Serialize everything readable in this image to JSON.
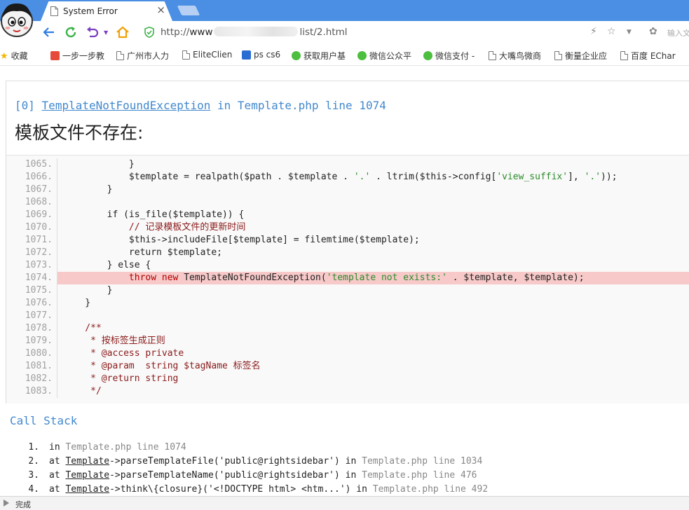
{
  "tab": {
    "title": "System Error",
    "close": "×"
  },
  "address": {
    "scheme": "http://",
    "host": "www",
    "path": "list/2.html",
    "search_placeholder": "输入文"
  },
  "bookmarks": [
    {
      "label": "收藏",
      "icon": "star-icon"
    },
    {
      "label": "一步一步教",
      "icon": "red-app-icon"
    },
    {
      "label": "广州市人力",
      "icon": "page-icon"
    },
    {
      "label": "EliteClien",
      "icon": "page-icon"
    },
    {
      "label": "ps cs6",
      "icon": "ps-icon"
    },
    {
      "label": "获取用户基",
      "icon": "wechat-icon"
    },
    {
      "label": "微信公众平",
      "icon": "wechat-icon"
    },
    {
      "label": "微信支付 -",
      "icon": "wechat-icon"
    },
    {
      "label": "大嘴鸟微商",
      "icon": "page-icon"
    },
    {
      "label": "衡量企业应",
      "icon": "page-icon"
    },
    {
      "label": "百度 EChar",
      "icon": "page-icon"
    }
  ],
  "exception": {
    "index": "[0]",
    "name": "TemplateNotFoundException",
    "in_text": "in",
    "location": "Template.php line 1074",
    "message": "模板文件不存在:"
  },
  "source": {
    "highlight_line": "1074.",
    "lines": [
      {
        "no": "1065.",
        "code": "            }"
      },
      {
        "no": "1066.",
        "code": "            $template = realpath($path . $template . '.' . ltrim($this->config['view_suffix'], '.'));"
      },
      {
        "no": "1067.",
        "code": "        }"
      },
      {
        "no": "1068.",
        "code": ""
      },
      {
        "no": "1069.",
        "code": "        if (is_file($template)) {"
      },
      {
        "no": "1070.",
        "code": "            // 记录模板文件的更新时间"
      },
      {
        "no": "1071.",
        "code": "            $this->includeFile[$template] = filemtime($template);"
      },
      {
        "no": "1072.",
        "code": "            return $template;"
      },
      {
        "no": "1073.",
        "code": "        } else {"
      },
      {
        "no": "1074.",
        "code": "            throw new TemplateNotFoundException('template not exists:' . $template, $template);"
      },
      {
        "no": "1075.",
        "code": "        }"
      },
      {
        "no": "1076.",
        "code": "    }"
      },
      {
        "no": "1077.",
        "code": ""
      },
      {
        "no": "1078.",
        "code": "    /**"
      },
      {
        "no": "1079.",
        "code": "     * 按标签生成正则"
      },
      {
        "no": "1080.",
        "code": "     * @access private"
      },
      {
        "no": "1081.",
        "code": "     * @param  string $tagName 标签名"
      },
      {
        "no": "1082.",
        "code": "     * @return string"
      },
      {
        "no": "1083.",
        "code": "     */"
      }
    ]
  },
  "call_stack": {
    "title": "Call Stack",
    "items": [
      {
        "no": "1.",
        "pre": "in ",
        "cls": "",
        "call": "",
        "loc": "Template.php line 1074"
      },
      {
        "no": "2.",
        "pre": "at ",
        "cls": "Template",
        "call": "->parseTemplateFile('public@rightsidebar') in ",
        "loc": "Template.php line 1034"
      },
      {
        "no": "3.",
        "pre": "at ",
        "cls": "Template",
        "call": "->parseTemplateName('public@rightsidebar') in ",
        "loc": "Template.php line 476"
      },
      {
        "no": "4.",
        "pre": "at ",
        "cls": "Template",
        "call": "->think\\{closure}('<!DOCTYPE html> <htm...') in ",
        "loc": "Template.php line 492"
      }
    ]
  },
  "status": {
    "text": "完成"
  },
  "colors": {
    "accent": "#4288ce",
    "tab_bar": "#4a8fe4",
    "highlight": "#f7c9c9"
  }
}
